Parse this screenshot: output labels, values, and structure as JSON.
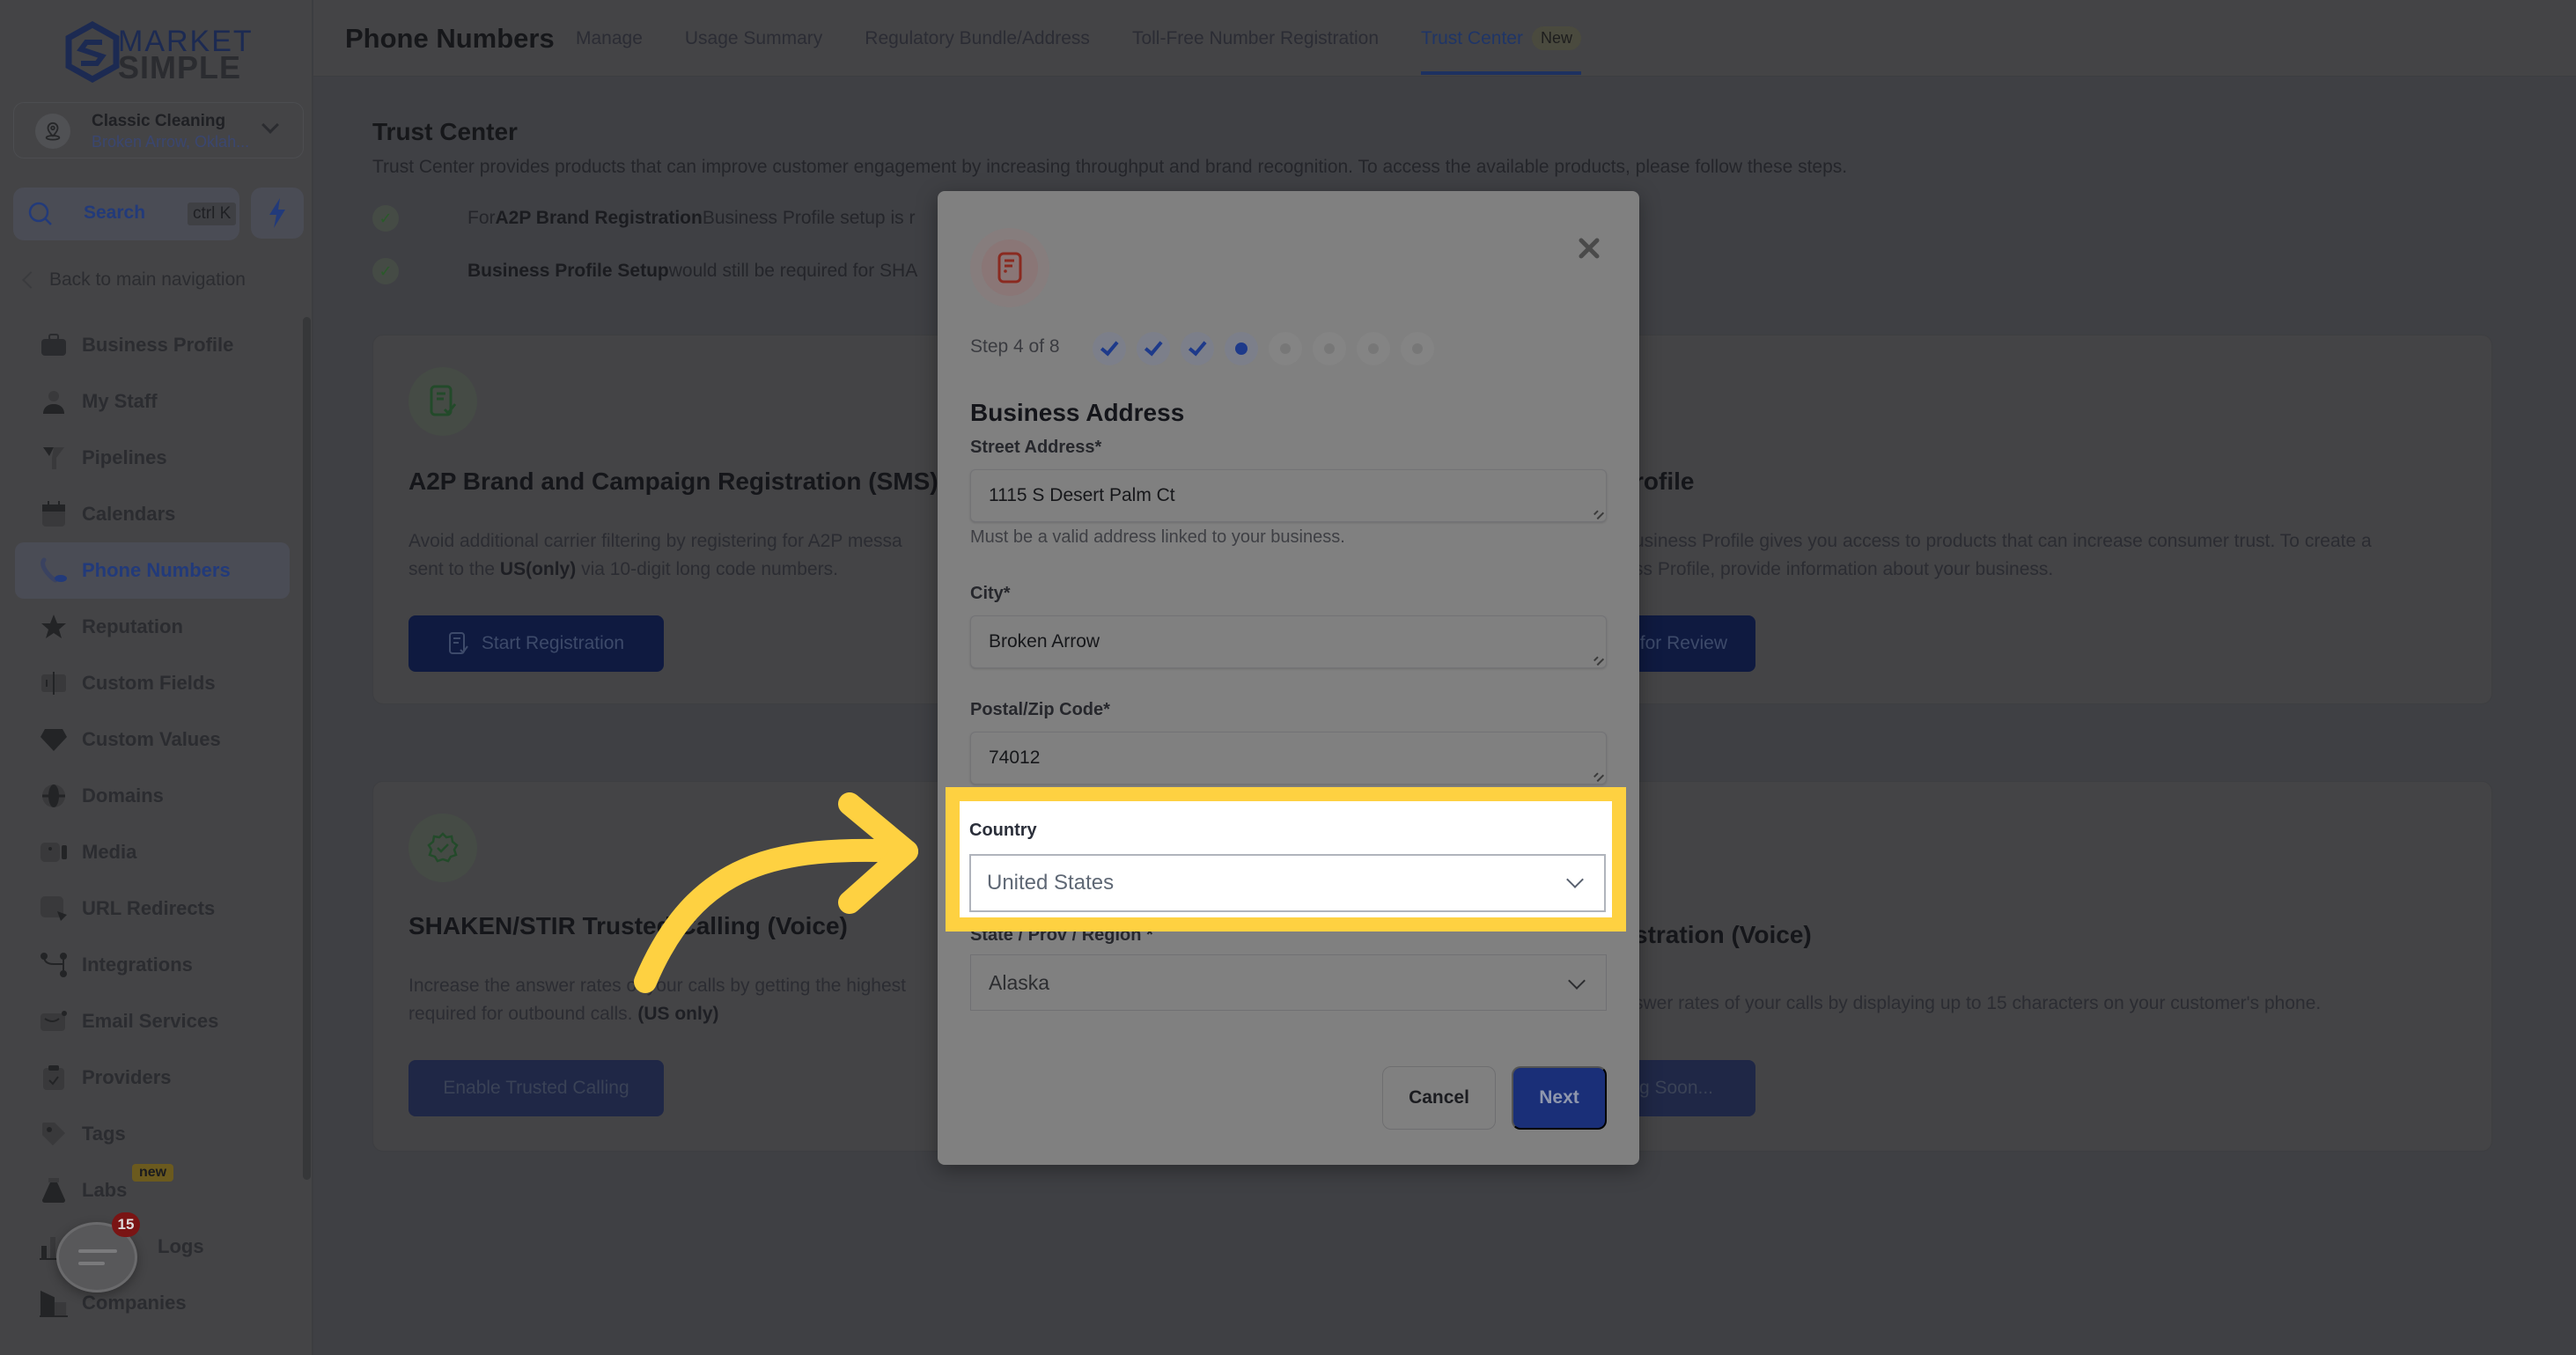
{
  "sidebar": {
    "logo": {
      "line1": "MARKET",
      "line2": "SIMPLE"
    },
    "org": {
      "name": "Classic Cleaning",
      "location": "Broken Arrow, Oklah..."
    },
    "search": {
      "label": "Search",
      "shortcut": "ctrl K"
    },
    "back_label": "Back to main navigation",
    "items": [
      {
        "label": "Business Profile",
        "icon": "briefcase-icon"
      },
      {
        "label": "My Staff",
        "icon": "user-icon"
      },
      {
        "label": "Pipelines",
        "icon": "funnel-icon"
      },
      {
        "label": "Calendars",
        "icon": "calendar-icon"
      },
      {
        "label": "Phone Numbers",
        "icon": "phone-icon",
        "active": true
      },
      {
        "label": "Reputation",
        "icon": "star-icon"
      },
      {
        "label": "Custom Fields",
        "icon": "custom-fields-icon"
      },
      {
        "label": "Custom Values",
        "icon": "diamond-icon"
      },
      {
        "label": "Domains",
        "icon": "globe-icon"
      },
      {
        "label": "Media",
        "icon": "video-icon"
      },
      {
        "label": "URL Redirects",
        "icon": "redirect-icon"
      },
      {
        "label": "Integrations",
        "icon": "integrations-icon"
      },
      {
        "label": "Email Services",
        "icon": "email-icon"
      },
      {
        "label": "Providers",
        "icon": "clipboard-icon"
      },
      {
        "label": "Tags",
        "icon": "tag-icon"
      },
      {
        "label": "Labs",
        "icon": "flask-icon",
        "badge": "new"
      },
      {
        "label": "Audit Logs",
        "icon": "chart-icon",
        "visible_label": "Logs"
      },
      {
        "label": "Companies",
        "icon": "building-icon"
      }
    ],
    "chat_badge_count": "15"
  },
  "header": {
    "title": "Phone Numbers",
    "tabs": [
      {
        "label": "Manage"
      },
      {
        "label": "Usage Summary"
      },
      {
        "label": "Regulatory Bundle/Address"
      },
      {
        "label": "Toll-Free Number Registration"
      },
      {
        "label": "Trust Center",
        "active": true,
        "badge": "New"
      }
    ]
  },
  "trust_center": {
    "title": "Trust Center",
    "description": "Trust Center provides products that can improve customer engagement by increasing throughput and brand recognition. To access the available products, please follow these steps.",
    "requirements": [
      {
        "prefix": "For ",
        "bold": "A2P Brand Registration",
        "suffix": " Business Profile setup is r"
      },
      {
        "prefix": "",
        "bold": "Business Profile Setup",
        "suffix": " would still be required for SHA"
      }
    ],
    "cards": [
      {
        "title": "A2P Brand and Campaign Registration (SMS)",
        "desc_line1": "Avoid additional carrier filtering by registering for A2P messa",
        "desc_line2_pre": "sent to the ",
        "desc_line2_bold": "US(only)",
        "desc_line2_post": " via 10-digit long code numbers.",
        "button": "Start Registration"
      },
      {
        "title_visible": "rofile",
        "desc_line1": "usiness Profile gives you access to products that can increase consumer trust. To create a",
        "desc_line2": "ss Profile, provide information about your business.",
        "button_visible": "for Review"
      },
      {
        "title": "SHAKEN/STIR Trusted Calling (Voice)",
        "desc_line1": "Increase the answer rates of your calls by getting the highest",
        "desc_line2_pre": "required for outbound calls. ",
        "desc_line2_bold": "(US only)",
        "button": "Enable Trusted Calling"
      },
      {
        "title_visible": "stration (Voice)",
        "desc_line1": "swer rates of your calls by displaying up to 15 characters on your customer's phone.",
        "button_visible": "g Soon..."
      }
    ]
  },
  "modal": {
    "step_label": "Step 4 of 8",
    "steps": {
      "total": 8,
      "current": 4,
      "completed": 3
    },
    "section_title": "Business Address",
    "fields": {
      "street": {
        "label": "Street Address*",
        "value": "1115 S Desert Palm Ct",
        "hint": "Must be a valid address linked to your business."
      },
      "city": {
        "label": "City*",
        "value": "Broken Arrow"
      },
      "postal": {
        "label": "Postal/Zip Code*",
        "value": "74012"
      },
      "country": {
        "label": "Country",
        "value": "United States"
      },
      "state": {
        "label": "State / Prov / Region *",
        "value": "Alaska"
      }
    },
    "cancel_label": "Cancel",
    "next_label": "Next"
  },
  "annotation": {
    "highlight_color": "#fed141",
    "target": "country-select"
  },
  "colors": {
    "accent": "#1a2f78",
    "highlight": "#fed141"
  }
}
